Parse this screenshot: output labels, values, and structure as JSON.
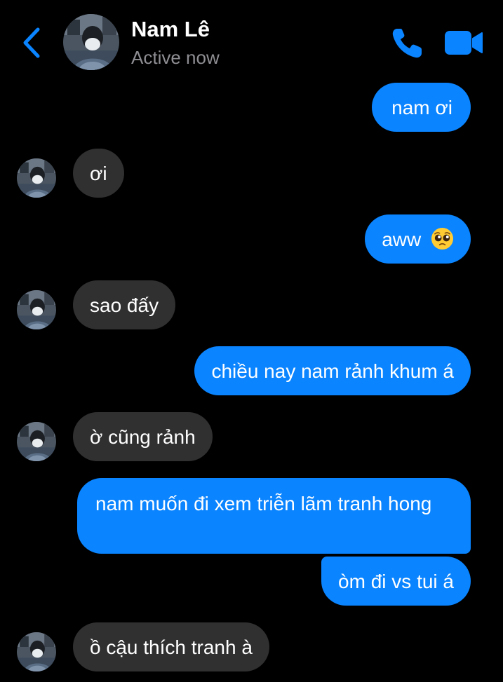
{
  "header": {
    "contact_name": "Nam Lê",
    "status": "Active now"
  },
  "colors": {
    "accent": "#0a84ff",
    "received_bubble": "#303030",
    "background": "#000000",
    "secondary_text": "#8e8e93"
  },
  "icons": {
    "back": "chevron-left-icon",
    "call": "phone-icon",
    "video": "video-camera-icon",
    "emoji": "pleading-face-emoji"
  },
  "messages": [
    {
      "sender": "me",
      "text": "nam ơi"
    },
    {
      "sender": "contact",
      "text": "ơi"
    },
    {
      "sender": "me",
      "text": "aww",
      "emoji": "🥺"
    },
    {
      "sender": "contact",
      "text": "sao đấy"
    },
    {
      "sender": "me",
      "text": "chiều nay nam rảnh khum á"
    },
    {
      "sender": "contact",
      "text": "ờ cũng rảnh"
    },
    {
      "sender": "me",
      "text": "nam muốn đi xem triễn lãm tranh hong"
    },
    {
      "sender": "me",
      "text": "òm đi vs tui á"
    },
    {
      "sender": "contact",
      "text": "ồ cậu thích tranh à"
    }
  ]
}
